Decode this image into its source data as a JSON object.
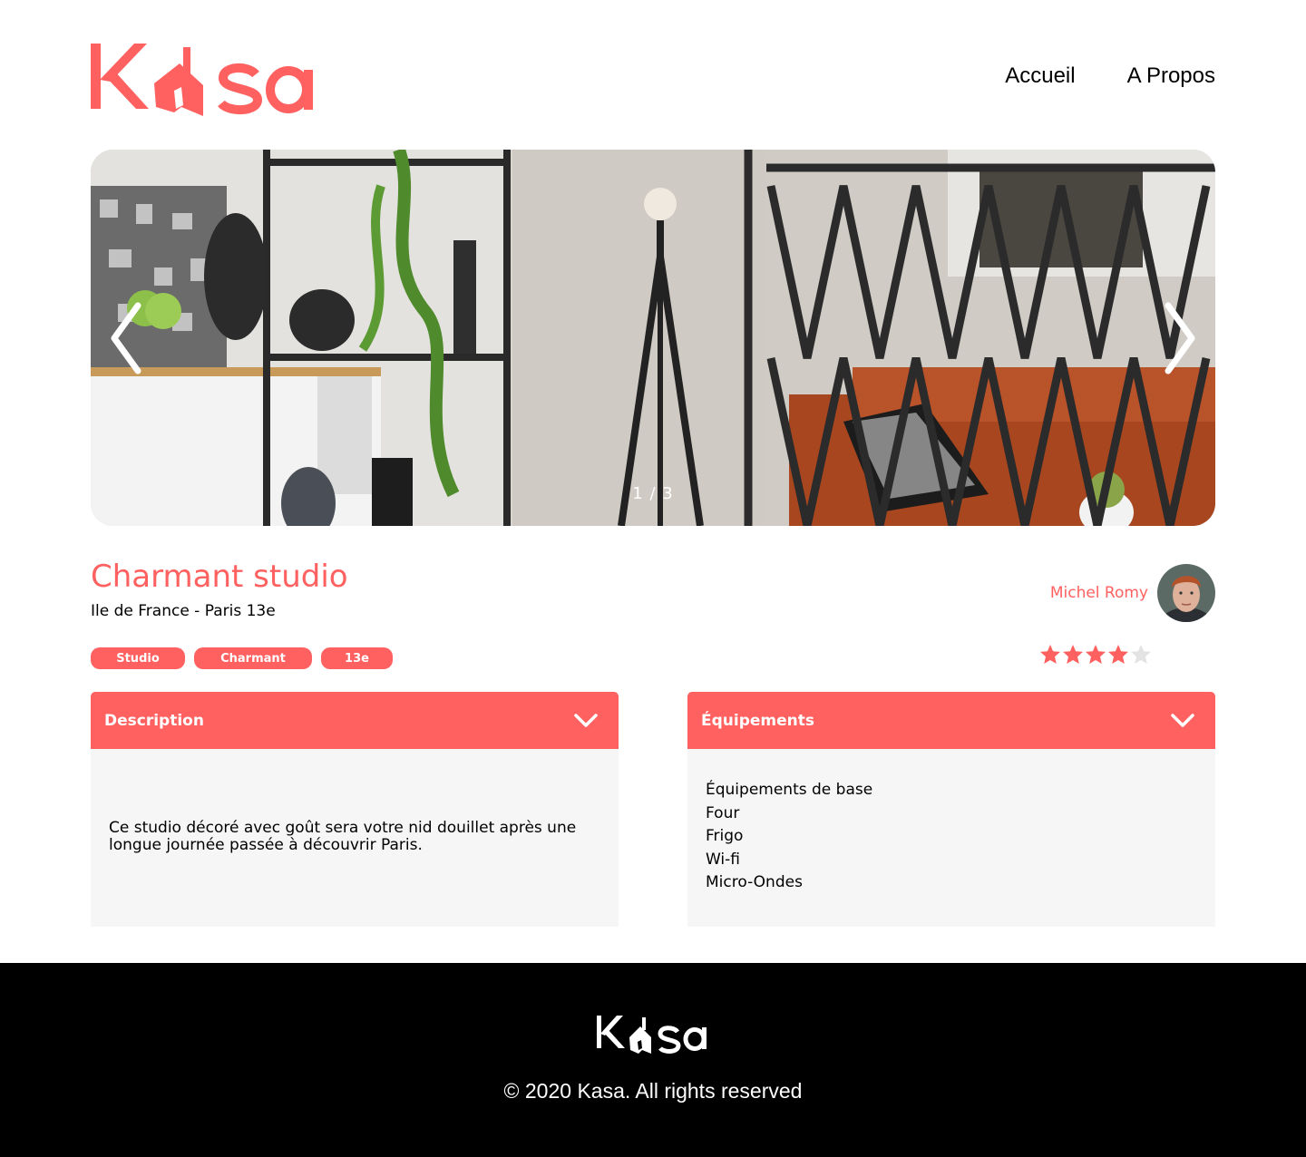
{
  "brand": {
    "name": "Kasa",
    "color": "#FF6060"
  },
  "nav": {
    "items": [
      {
        "label": "Accueil"
      },
      {
        "label": "A Propos"
      }
    ]
  },
  "carousel": {
    "counter": "1 / 3",
    "prev_icon": "chevron-left-icon",
    "next_icon": "chevron-right-icon"
  },
  "listing": {
    "title": "Charmant studio",
    "location": "Ile de France - Paris 13e",
    "tags": [
      "Studio",
      "Charmant",
      "13e"
    ],
    "host": {
      "name": "Michel Romy"
    },
    "rating": {
      "value": 4,
      "max": 5
    }
  },
  "collapses": {
    "description": {
      "title": "Description",
      "text": "Ce studio décoré avec goût sera votre nid douillet après une longue journée passée à découvrir Paris."
    },
    "equipments": {
      "title": "Équipements",
      "items": [
        "Équipements de base",
        "Four",
        "Frigo",
        "Wi-fi",
        "Micro-Ondes"
      ]
    }
  },
  "footer": {
    "copyright": "© 2020 Kasa. All rights reserved"
  }
}
